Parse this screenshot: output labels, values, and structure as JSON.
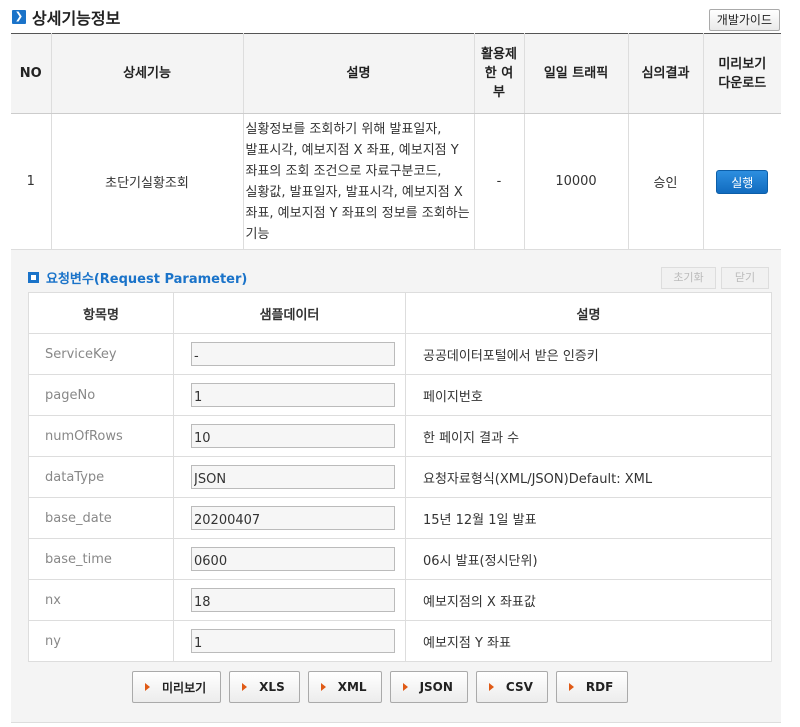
{
  "section": {
    "title": "상세기능정보",
    "dev_guide_label": "개발가이드"
  },
  "main_table": {
    "headers": {
      "no": "NO",
      "feature": "상세기능",
      "desc": "설명",
      "limit_line1": "활용제",
      "limit_line2": "한 여",
      "limit_line3": "부",
      "traffic": "일일 트래픽",
      "review": "심의결과",
      "preview_line1": "미리보기",
      "preview_line2": "다운로드"
    },
    "row": {
      "no": "1",
      "feature": "초단기실황조회",
      "desc": "실황정보를 조회하기 위해 발표일자, 발표시각, 예보지점 X 좌표, 예보지점 Y 좌표의 조회 조건으로 자료구분코드, 실황값, 발표일자, 발표시각, 예보지점 X 좌표, 예보지점 Y 좌표의 정보를 조회하는 기능",
      "limit": "-",
      "traffic": "10000",
      "review": "승인",
      "run_label": "실행"
    }
  },
  "request": {
    "title": "요청변수(Request Parameter)",
    "reset_label": "초기화",
    "close_label": "닫기",
    "headers": {
      "name": "항목명",
      "sample": "샘플데이터",
      "desc": "설명"
    },
    "params": [
      {
        "name": "ServiceKey",
        "sample": "-",
        "desc": "공공데이터포털에서 받은 인증키"
      },
      {
        "name": "pageNo",
        "sample": "1",
        "desc": "페이지번호"
      },
      {
        "name": "numOfRows",
        "sample": "10",
        "desc": "한 페이지 결과 수"
      },
      {
        "name": "dataType",
        "sample": "JSON",
        "desc": "요청자료형식(XML/JSON)Default: XML"
      },
      {
        "name": "base_date",
        "sample": "20200407",
        "desc": "15년 12월 1일 발표"
      },
      {
        "name": "base_time",
        "sample": "0600",
        "desc": "06시 발표(정시단위)"
      },
      {
        "name": "nx",
        "sample": "18",
        "desc": "예보지점의 X 좌표값"
      },
      {
        "name": "ny",
        "sample": "1",
        "desc": "예보지점 Y 좌표"
      }
    ],
    "format_buttons": [
      "미리보기",
      "XLS",
      "XML",
      "JSON",
      "CSV",
      "RDF"
    ]
  }
}
